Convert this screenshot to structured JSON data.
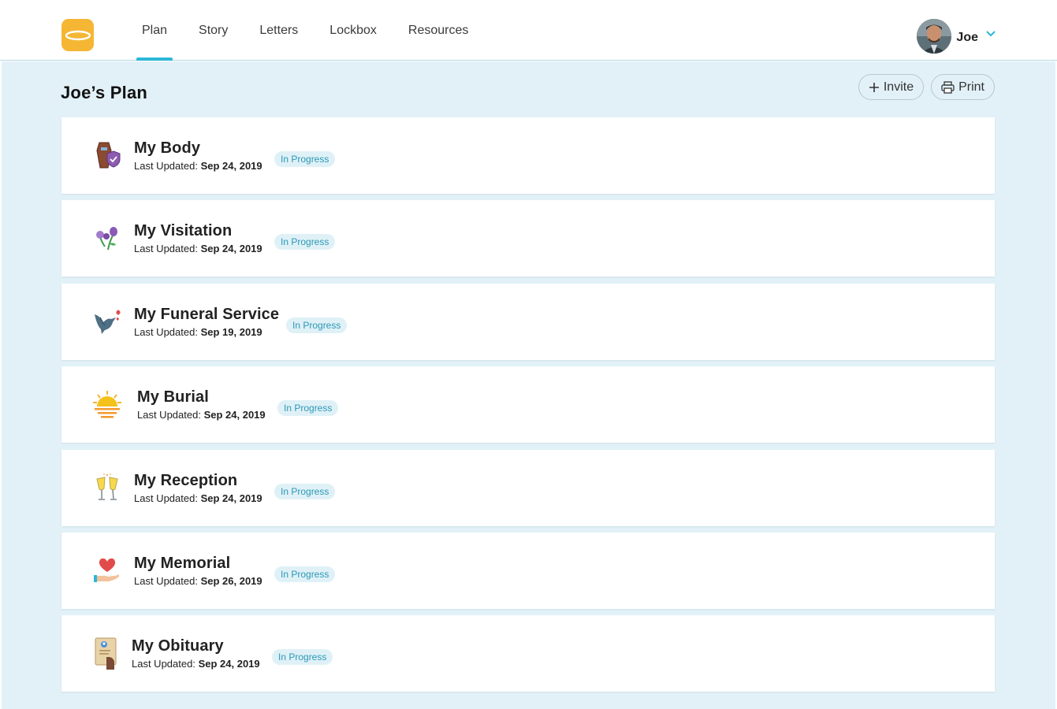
{
  "nav": {
    "items": [
      {
        "label": "Plan",
        "active": true
      },
      {
        "label": "Story",
        "active": false
      },
      {
        "label": "Letters",
        "active": false
      },
      {
        "label": "Lockbox",
        "active": false
      },
      {
        "label": "Resources",
        "active": false
      }
    ]
  },
  "user": {
    "name": "Joe"
  },
  "page": {
    "title": "Joe’s Plan"
  },
  "actions": {
    "invite": "Invite",
    "print": "Print"
  },
  "sections": [
    {
      "title": "My Body",
      "updated_label": "Last Updated:",
      "updated": "Sep 24, 2019",
      "status": "In Progress",
      "icon": "casket-icon"
    },
    {
      "title": "My Visitation",
      "updated_label": "Last Updated:",
      "updated": "Sep 24, 2019",
      "status": "In Progress",
      "icon": "flowers-icon"
    },
    {
      "title": "My Funeral Service",
      "updated_label": "Last Updated:",
      "updated": "Sep 19, 2019",
      "status": "In Progress",
      "icon": "dove-icon"
    },
    {
      "title": "My Burial",
      "updated_label": "Last Updated:",
      "updated": "Sep 24, 2019",
      "status": "In Progress",
      "icon": "sunset-icon"
    },
    {
      "title": "My Reception",
      "updated_label": "Last Updated:",
      "updated": "Sep 24, 2019",
      "status": "In Progress",
      "icon": "champagne-icon"
    },
    {
      "title": "My Memorial",
      "updated_label": "Last Updated:",
      "updated": "Sep 26, 2019",
      "status": "In Progress",
      "icon": "heart-hand-icon"
    },
    {
      "title": "My Obituary",
      "updated_label": "Last Updated:",
      "updated": "Sep 24, 2019",
      "status": "In Progress",
      "icon": "obituary-scroll-icon"
    }
  ],
  "colors": {
    "accent": "#2bb7d8",
    "logo": "#f5b634",
    "background": "#e2f1f8",
    "badge_bg": "#dff1f7",
    "badge_text": "#2d98b6"
  }
}
